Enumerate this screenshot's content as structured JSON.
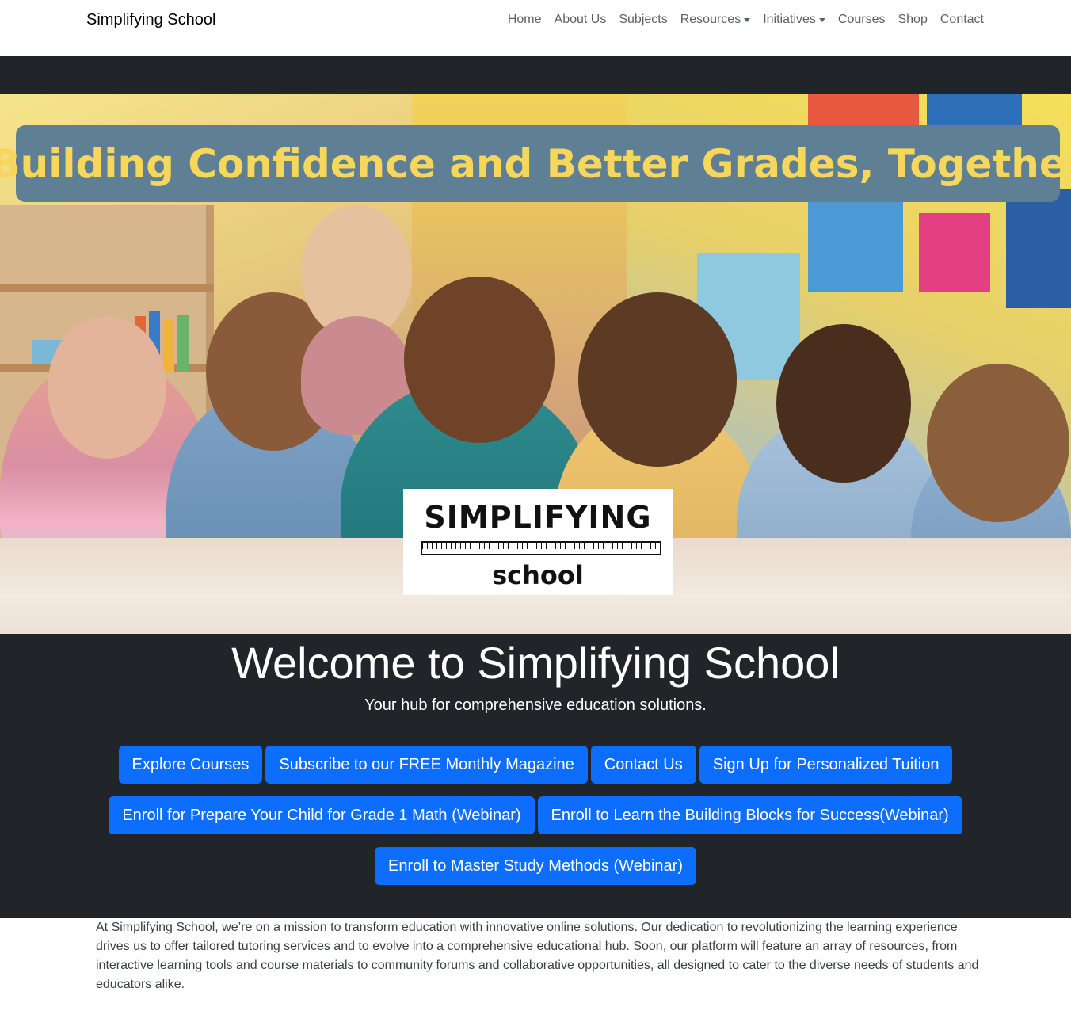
{
  "navbar": {
    "brand": "Simplifying School",
    "links": [
      {
        "label": "Home",
        "dropdown": false
      },
      {
        "label": "About Us",
        "dropdown": false
      },
      {
        "label": "Subjects",
        "dropdown": false
      },
      {
        "label": "Resources",
        "dropdown": true
      },
      {
        "label": "Initiatives",
        "dropdown": true
      },
      {
        "label": "Courses",
        "dropdown": false
      },
      {
        "label": "Shop",
        "dropdown": false
      },
      {
        "label": "Contact",
        "dropdown": false
      }
    ]
  },
  "hero": {
    "banner_text": "Building Confidence and Better Grades, Together",
    "logo": {
      "word": "SIMPLIFYING",
      "subword": "school"
    },
    "title": "Welcome to Simplifying School",
    "tagline": "Your hub for comprehensive education solutions.",
    "buttons_row1": [
      "Explore Courses",
      "Subscribe to our FREE Monthly Magazine",
      "Contact Us",
      "Sign Up for Personalized Tuition"
    ],
    "buttons_row2": [
      "Enroll for Prepare Your Child for Grade 1 Math (Webinar)",
      "Enroll to Learn the Building Blocks for Success(Webinar)"
    ],
    "buttons_row3": [
      "Enroll to Master Study Methods (Webinar)"
    ]
  },
  "about": {
    "text": "At Simplifying School, we’re on a mission to transform education with innovative online solutions. Our dedication to revolutionizing the learning experience drives us to offer tailored tutoring services and to evolve into a comprehensive educational hub. Soon, our platform will feature an array of resources, from interactive learning tools and course materials to community forums and collaborative opportunities, all designed to cater to the diverse needs of students and educators alike."
  },
  "colors": {
    "primary_button": "#0d6efd",
    "hero_background": "#212529",
    "banner_background": "#5f7f95",
    "banner_text": "#f7d65c"
  }
}
